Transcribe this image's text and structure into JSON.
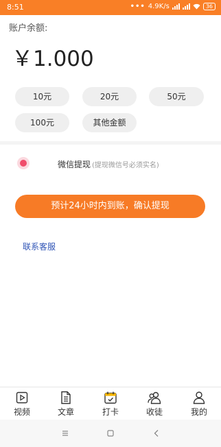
{
  "status_bar": {
    "time": "8:51",
    "network_speed": "4.9K/s",
    "battery": "36"
  },
  "balance": {
    "label": "账户余额:",
    "amount": "￥1.000"
  },
  "amount_options": [
    "10元",
    "20元",
    "50元",
    "100元",
    "其他金额"
  ],
  "withdraw_method": {
    "label": "微信提现",
    "note": "(提现微信号必须实名)"
  },
  "confirm_button": "预计24小时内到账，确认提现",
  "contact_link": "联系客服",
  "bottom_nav": [
    {
      "label": "视频",
      "icon": "video-icon"
    },
    {
      "label": "文章",
      "icon": "article-icon"
    },
    {
      "label": "打卡",
      "icon": "calendar-icon"
    },
    {
      "label": "收徒",
      "icon": "users-icon"
    },
    {
      "label": "我的",
      "icon": "user-icon"
    }
  ],
  "colors": {
    "brand_orange": "#f77b26",
    "radio_red": "#f04d6b",
    "link_blue": "#2f54b6"
  }
}
